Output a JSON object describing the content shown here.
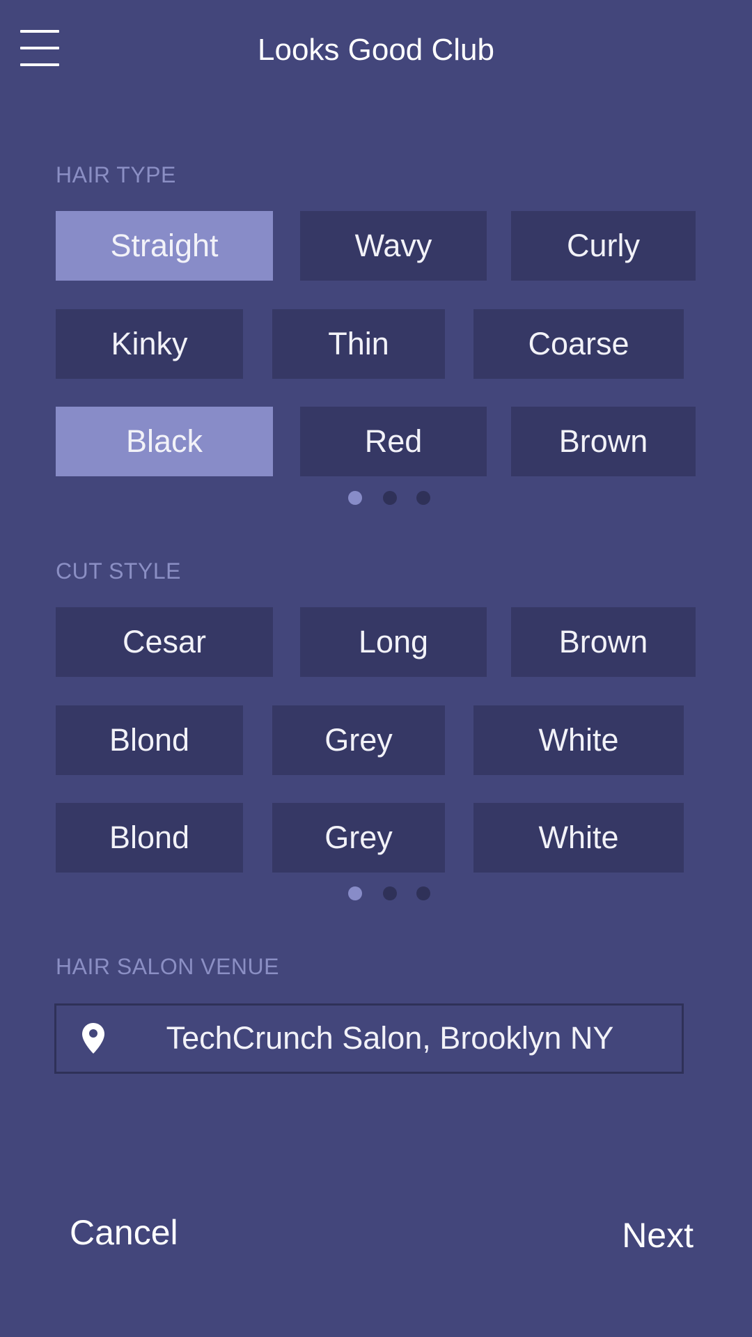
{
  "header": {
    "title": "Looks Good Club",
    "menu_icon": "hamburger-menu-icon"
  },
  "hair_type": {
    "label": "HAIR TYPE",
    "rows": [
      [
        {
          "label": "Straight",
          "selected": true
        },
        {
          "label": "Wavy",
          "selected": false
        },
        {
          "label": "Curly",
          "selected": false
        }
      ],
      [
        {
          "label": "Kinky",
          "selected": false
        },
        {
          "label": "Thin",
          "selected": false
        },
        {
          "label": "Coarse",
          "selected": false
        }
      ],
      [
        {
          "label": "Black",
          "selected": true
        },
        {
          "label": "Red",
          "selected": false
        },
        {
          "label": "Brown",
          "selected": false
        }
      ]
    ],
    "pager": {
      "pages": 3,
      "active": 1
    }
  },
  "cut_style": {
    "label": "CUT STYLE",
    "rows": [
      [
        {
          "label": "Cesar",
          "selected": false
        },
        {
          "label": "Long",
          "selected": false
        },
        {
          "label": "Brown",
          "selected": false
        }
      ],
      [
        {
          "label": "Blond",
          "selected": false
        },
        {
          "label": "Grey",
          "selected": false
        },
        {
          "label": "White",
          "selected": false
        }
      ],
      [
        {
          "label": "Blond",
          "selected": false
        },
        {
          "label": "Grey",
          "selected": false
        },
        {
          "label": "White",
          "selected": false
        }
      ]
    ],
    "pager": {
      "pages": 3,
      "active": 1
    }
  },
  "venue": {
    "label": "HAIR SALON VENUE",
    "value": "TechCrunch Salon, Brooklyn NY",
    "icon": "location-pin-icon"
  },
  "footer": {
    "cancel_label": "Cancel",
    "next_label": "Next"
  },
  "colors": {
    "background": "#43467b",
    "chip": "#363865",
    "chip_selected": "#888cc8",
    "section_label": "#8b8fc4",
    "dot_inactive": "#2f3158",
    "dot_active": "#888cc8"
  }
}
